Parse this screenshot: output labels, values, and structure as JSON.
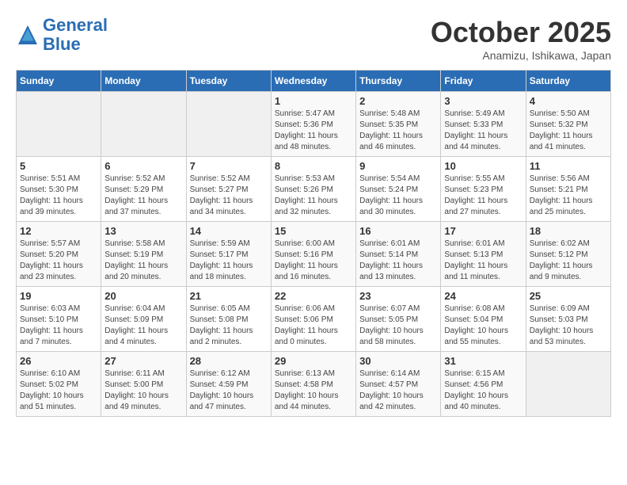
{
  "header": {
    "logo_line1": "General",
    "logo_line2": "Blue",
    "month_title": "October 2025",
    "subtitle": "Anamizu, Ishikawa, Japan"
  },
  "weekdays": [
    "Sunday",
    "Monday",
    "Tuesday",
    "Wednesday",
    "Thursday",
    "Friday",
    "Saturday"
  ],
  "weeks": [
    [
      {
        "day": "",
        "sunrise": "",
        "sunset": "",
        "daylight": ""
      },
      {
        "day": "",
        "sunrise": "",
        "sunset": "",
        "daylight": ""
      },
      {
        "day": "",
        "sunrise": "",
        "sunset": "",
        "daylight": ""
      },
      {
        "day": "1",
        "sunrise": "Sunrise: 5:47 AM",
        "sunset": "Sunset: 5:36 PM",
        "daylight": "Daylight: 11 hours and 48 minutes."
      },
      {
        "day": "2",
        "sunrise": "Sunrise: 5:48 AM",
        "sunset": "Sunset: 5:35 PM",
        "daylight": "Daylight: 11 hours and 46 minutes."
      },
      {
        "day": "3",
        "sunrise": "Sunrise: 5:49 AM",
        "sunset": "Sunset: 5:33 PM",
        "daylight": "Daylight: 11 hours and 44 minutes."
      },
      {
        "day": "4",
        "sunrise": "Sunrise: 5:50 AM",
        "sunset": "Sunset: 5:32 PM",
        "daylight": "Daylight: 11 hours and 41 minutes."
      }
    ],
    [
      {
        "day": "5",
        "sunrise": "Sunrise: 5:51 AM",
        "sunset": "Sunset: 5:30 PM",
        "daylight": "Daylight: 11 hours and 39 minutes."
      },
      {
        "day": "6",
        "sunrise": "Sunrise: 5:52 AM",
        "sunset": "Sunset: 5:29 PM",
        "daylight": "Daylight: 11 hours and 37 minutes."
      },
      {
        "day": "7",
        "sunrise": "Sunrise: 5:52 AM",
        "sunset": "Sunset: 5:27 PM",
        "daylight": "Daylight: 11 hours and 34 minutes."
      },
      {
        "day": "8",
        "sunrise": "Sunrise: 5:53 AM",
        "sunset": "Sunset: 5:26 PM",
        "daylight": "Daylight: 11 hours and 32 minutes."
      },
      {
        "day": "9",
        "sunrise": "Sunrise: 5:54 AM",
        "sunset": "Sunset: 5:24 PM",
        "daylight": "Daylight: 11 hours and 30 minutes."
      },
      {
        "day": "10",
        "sunrise": "Sunrise: 5:55 AM",
        "sunset": "Sunset: 5:23 PM",
        "daylight": "Daylight: 11 hours and 27 minutes."
      },
      {
        "day": "11",
        "sunrise": "Sunrise: 5:56 AM",
        "sunset": "Sunset: 5:21 PM",
        "daylight": "Daylight: 11 hours and 25 minutes."
      }
    ],
    [
      {
        "day": "12",
        "sunrise": "Sunrise: 5:57 AM",
        "sunset": "Sunset: 5:20 PM",
        "daylight": "Daylight: 11 hours and 23 minutes."
      },
      {
        "day": "13",
        "sunrise": "Sunrise: 5:58 AM",
        "sunset": "Sunset: 5:19 PM",
        "daylight": "Daylight: 11 hours and 20 minutes."
      },
      {
        "day": "14",
        "sunrise": "Sunrise: 5:59 AM",
        "sunset": "Sunset: 5:17 PM",
        "daylight": "Daylight: 11 hours and 18 minutes."
      },
      {
        "day": "15",
        "sunrise": "Sunrise: 6:00 AM",
        "sunset": "Sunset: 5:16 PM",
        "daylight": "Daylight: 11 hours and 16 minutes."
      },
      {
        "day": "16",
        "sunrise": "Sunrise: 6:01 AM",
        "sunset": "Sunset: 5:14 PM",
        "daylight": "Daylight: 11 hours and 13 minutes."
      },
      {
        "day": "17",
        "sunrise": "Sunrise: 6:01 AM",
        "sunset": "Sunset: 5:13 PM",
        "daylight": "Daylight: 11 hours and 11 minutes."
      },
      {
        "day": "18",
        "sunrise": "Sunrise: 6:02 AM",
        "sunset": "Sunset: 5:12 PM",
        "daylight": "Daylight: 11 hours and 9 minutes."
      }
    ],
    [
      {
        "day": "19",
        "sunrise": "Sunrise: 6:03 AM",
        "sunset": "Sunset: 5:10 PM",
        "daylight": "Daylight: 11 hours and 7 minutes."
      },
      {
        "day": "20",
        "sunrise": "Sunrise: 6:04 AM",
        "sunset": "Sunset: 5:09 PM",
        "daylight": "Daylight: 11 hours and 4 minutes."
      },
      {
        "day": "21",
        "sunrise": "Sunrise: 6:05 AM",
        "sunset": "Sunset: 5:08 PM",
        "daylight": "Daylight: 11 hours and 2 minutes."
      },
      {
        "day": "22",
        "sunrise": "Sunrise: 6:06 AM",
        "sunset": "Sunset: 5:06 PM",
        "daylight": "Daylight: 11 hours and 0 minutes."
      },
      {
        "day": "23",
        "sunrise": "Sunrise: 6:07 AM",
        "sunset": "Sunset: 5:05 PM",
        "daylight": "Daylight: 10 hours and 58 minutes."
      },
      {
        "day": "24",
        "sunrise": "Sunrise: 6:08 AM",
        "sunset": "Sunset: 5:04 PM",
        "daylight": "Daylight: 10 hours and 55 minutes."
      },
      {
        "day": "25",
        "sunrise": "Sunrise: 6:09 AM",
        "sunset": "Sunset: 5:03 PM",
        "daylight": "Daylight: 10 hours and 53 minutes."
      }
    ],
    [
      {
        "day": "26",
        "sunrise": "Sunrise: 6:10 AM",
        "sunset": "Sunset: 5:02 PM",
        "daylight": "Daylight: 10 hours and 51 minutes."
      },
      {
        "day": "27",
        "sunrise": "Sunrise: 6:11 AM",
        "sunset": "Sunset: 5:00 PM",
        "daylight": "Daylight: 10 hours and 49 minutes."
      },
      {
        "day": "28",
        "sunrise": "Sunrise: 6:12 AM",
        "sunset": "Sunset: 4:59 PM",
        "daylight": "Daylight: 10 hours and 47 minutes."
      },
      {
        "day": "29",
        "sunrise": "Sunrise: 6:13 AM",
        "sunset": "Sunset: 4:58 PM",
        "daylight": "Daylight: 10 hours and 44 minutes."
      },
      {
        "day": "30",
        "sunrise": "Sunrise: 6:14 AM",
        "sunset": "Sunset: 4:57 PM",
        "daylight": "Daylight: 10 hours and 42 minutes."
      },
      {
        "day": "31",
        "sunrise": "Sunrise: 6:15 AM",
        "sunset": "Sunset: 4:56 PM",
        "daylight": "Daylight: 10 hours and 40 minutes."
      },
      {
        "day": "",
        "sunrise": "",
        "sunset": "",
        "daylight": ""
      }
    ]
  ]
}
